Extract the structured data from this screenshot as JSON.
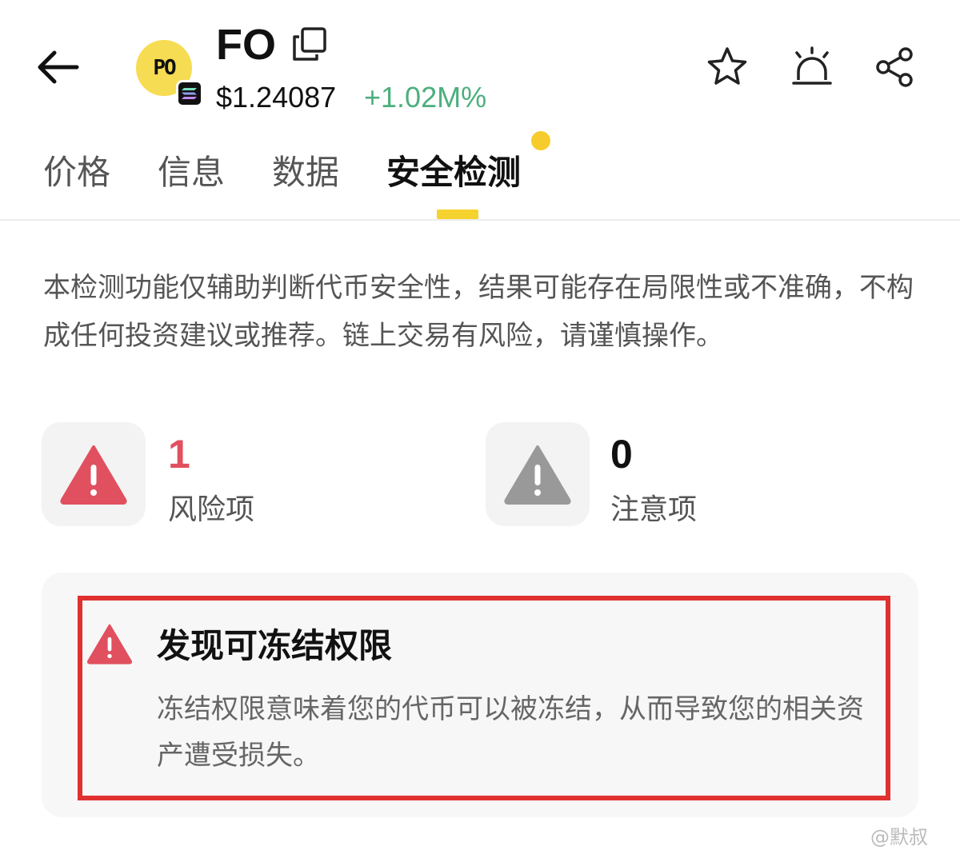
{
  "header": {
    "back_icon": "arrow-left-icon",
    "token_logo_text": "PO",
    "chain_icon": "solana-icon",
    "symbol": "FO",
    "copy_icon": "copy-icon",
    "price": "$1.24087",
    "change": "+1.02M%",
    "change_color": "#4caf7d",
    "actions": [
      "star-icon",
      "alarm-icon",
      "share-icon"
    ]
  },
  "tabs": [
    {
      "label": "价格",
      "active": false
    },
    {
      "label": "信息",
      "active": false
    },
    {
      "label": "数据",
      "active": false
    },
    {
      "label": "安全检测",
      "active": true
    }
  ],
  "disclaimer": "本检测功能仅辅助判断代币安全性，结果可能存在局限性或不准确，不构成任何投资建议或推荐。链上交易有风险，请谨慎操作。",
  "stats": {
    "risk": {
      "count": "1",
      "label": "风险项",
      "color": "#e0505e",
      "icon": "warning-triangle-icon"
    },
    "caution": {
      "count": "0",
      "label": "注意项",
      "color": "#999999",
      "icon": "warning-triangle-icon"
    }
  },
  "alert": {
    "icon": "warning-triangle-icon",
    "title": "发现可冻结权限",
    "description": "冻结权限意味着您的代币可以被冻结，从而导致您的相关资产遭受损失。",
    "highlight_color": "#e03030"
  },
  "watermark": "@默叔"
}
